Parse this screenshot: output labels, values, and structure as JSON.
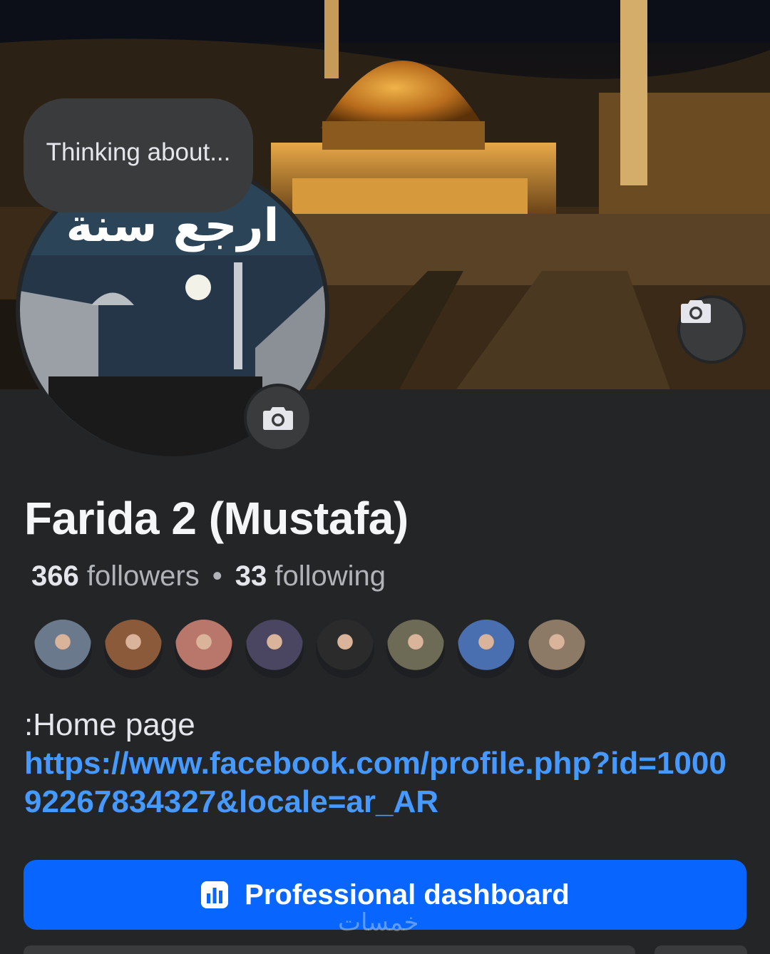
{
  "profile": {
    "name": "Farida 2 (Mustafa)",
    "note_placeholder": "Thinking about...",
    "avatar_caption": "ارجع سنة",
    "followers_count": "366",
    "followers_label": "followers",
    "following_count": "33",
    "following_label": "following"
  },
  "friends": [
    {
      "color": "#6a7a8c"
    },
    {
      "color": "#8b5a3a"
    },
    {
      "color": "#b9766a"
    },
    {
      "color": "#4a4560"
    },
    {
      "color": "#2b2b2b"
    },
    {
      "color": "#6d6a55"
    },
    {
      "color": "#4a6fb0"
    },
    {
      "color": "#8c7a66"
    }
  ],
  "about": {
    "homepage_label": ":Home page",
    "homepage_url": "https://www.facebook.com/profile.php?id=100092267834327&locale=ar_AR"
  },
  "actions": {
    "dashboard_label": "Professional dashboard"
  },
  "watermark": "خمسات",
  "icons": [
    "camera-icon",
    "dashboard-icon"
  ],
  "colors": {
    "background": "#242526",
    "button_blue": "#0866ff",
    "link_blue": "#4599ff"
  }
}
